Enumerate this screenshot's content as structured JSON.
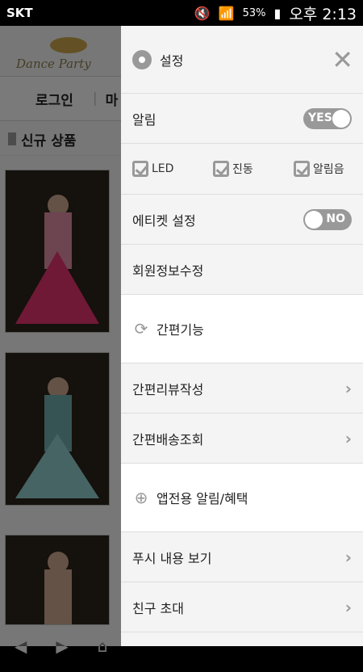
{
  "status": {
    "carrier": "SKT",
    "battery": "53%",
    "time": "오후 2:13"
  },
  "background": {
    "logo_text": "Dance Party",
    "nav": {
      "login": "로그인",
      "next": "마"
    },
    "section_title": "신규 상품"
  },
  "drawer": {
    "title": "설정",
    "alarm": {
      "label": "알림",
      "toggle": "YES"
    },
    "checks": [
      {
        "label": "LED"
      },
      {
        "label": "진동"
      },
      {
        "label": "알림음"
      }
    ],
    "etiquette": {
      "label": "에티켓 설정",
      "toggle": "NO"
    },
    "member_edit": "회원정보수정",
    "quick_group": "간편기능",
    "quick_items": [
      "간편리뷰작성",
      "간편배송조회"
    ],
    "app_group": "앱전용 알림/혜택",
    "app_items": [
      "푸시 내용 보기",
      "친구 초대"
    ]
  },
  "colors": {
    "drawer_bg": "#f4f4f4",
    "toggle": "#999999",
    "dim": "rgba(0,0,0,0.5)"
  }
}
